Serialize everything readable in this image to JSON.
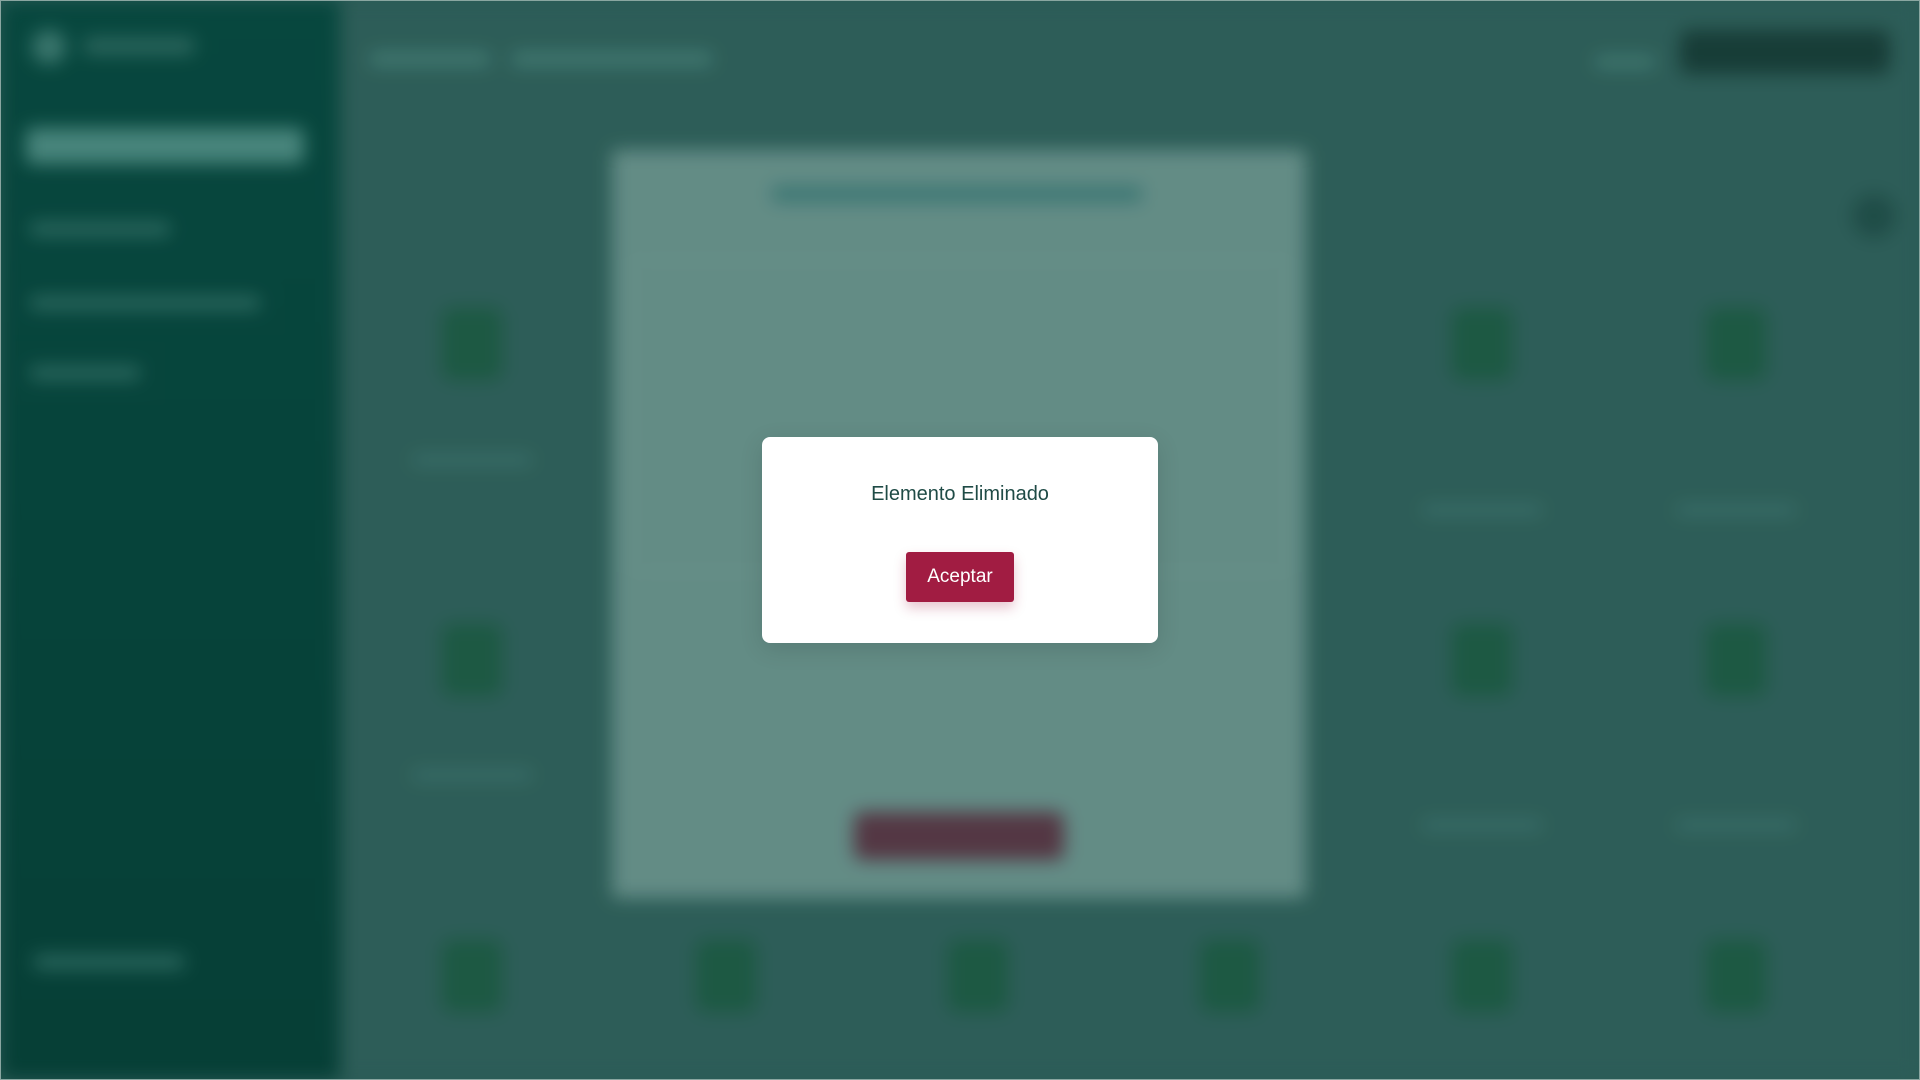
{
  "dialog": {
    "message": "Elemento Eliminado",
    "accept_label": "Aceptar"
  },
  "colors": {
    "sidebar": "#04463c",
    "background": "#2e5e58",
    "accent": "#a11c42",
    "dialog_text": "#1f4b46"
  }
}
